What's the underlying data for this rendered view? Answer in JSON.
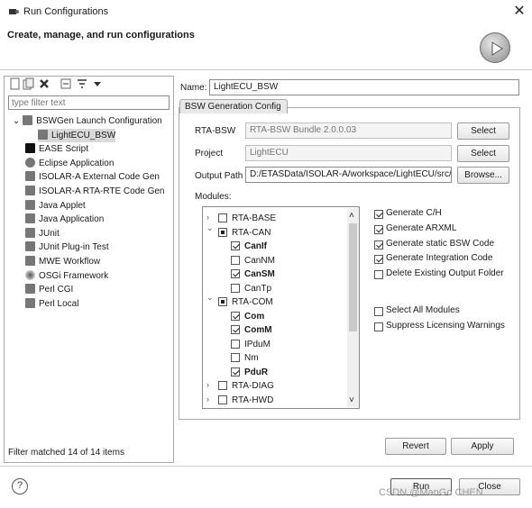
{
  "window": {
    "title": "Run Configurations",
    "close_glyph": "✕"
  },
  "header": {
    "title": "Create, manage, and run configurations",
    "run_icon": "run-play-icon"
  },
  "left": {
    "toolbar_icons": [
      "new-config-icon",
      "duplicate-icon",
      "delete-icon",
      "collapse-all-icon",
      "filter-icon",
      "view-menu-icon"
    ],
    "filter_placeholder": "type filter text",
    "tree": [
      {
        "label": "BSWGen Launch Configuration",
        "icon": "bswgen-icon",
        "expanded": true
      },
      {
        "label": "LightECU_BSW",
        "icon": "config-icon",
        "selected": true
      },
      {
        "label": "EASE Script",
        "icon": "ease-icon"
      },
      {
        "label": "Eclipse Application",
        "icon": "eclipse-icon"
      },
      {
        "label": "ISOLAR-A External Code Gen",
        "icon": "doc-icon"
      },
      {
        "label": "ISOLAR-A RTA-RTE Code Gen",
        "icon": "doc-icon"
      },
      {
        "label": "Java Applet",
        "icon": "java-icon"
      },
      {
        "label": "Java Application",
        "icon": "java-app-icon"
      },
      {
        "label": "JUnit",
        "icon": "junit-icon"
      },
      {
        "label": "JUnit Plug-in Test",
        "icon": "junit-plugin-icon"
      },
      {
        "label": "MWE Workflow",
        "icon": "mwe-icon"
      },
      {
        "label": "OSGi Framework",
        "icon": "osgi-icon"
      },
      {
        "label": "Perl CGI",
        "icon": "perl-icon"
      },
      {
        "label": "Perl Local",
        "icon": "perl-icon"
      }
    ],
    "filter_status": "Filter matched 14 of 14 items"
  },
  "right": {
    "name_label": "Name:",
    "name_value": "LightECU_BSW",
    "tab_label": "BSW Generation Config",
    "rta_bsw_label": "RTA-BSW",
    "rta_bsw_value": "RTA-BSW Bundle 2.0.0.03",
    "project_label": "Project",
    "project_value": "LightECU",
    "output_label": "Output Path",
    "output_value": "D:/ETASData/ISOLAR-A/workspace/LightECU/src/",
    "select_label": "Select",
    "browse_label": "Browse...",
    "modules_label": "Modules:",
    "modules": [
      {
        "label": "RTA-BASE",
        "level": 0,
        "arrow": "›",
        "state": "off",
        "bold": false
      },
      {
        "label": "RTA-CAN",
        "level": 0,
        "arrow": "⌄",
        "state": "part",
        "bold": false
      },
      {
        "label": "CanIf",
        "level": 1,
        "state": "on",
        "bold": true
      },
      {
        "label": "CanNM",
        "level": 1,
        "state": "off",
        "bold": false
      },
      {
        "label": "CanSM",
        "level": 1,
        "state": "on",
        "bold": true
      },
      {
        "label": "CanTp",
        "level": 1,
        "state": "off",
        "bold": false
      },
      {
        "label": "RTA-COM",
        "level": 0,
        "arrow": "⌄",
        "state": "part",
        "bold": false
      },
      {
        "label": "Com",
        "level": 1,
        "state": "on",
        "bold": true
      },
      {
        "label": "ComM",
        "level": 1,
        "state": "on",
        "bold": true
      },
      {
        "label": "IPduM",
        "level": 1,
        "state": "off",
        "bold": false
      },
      {
        "label": "Nm",
        "level": 1,
        "state": "off",
        "bold": false
      },
      {
        "label": "PduR",
        "level": 1,
        "state": "on",
        "bold": true
      },
      {
        "label": "RTA-DIAG",
        "level": 0,
        "arrow": "›",
        "state": "off",
        "bold": false
      },
      {
        "label": "RTA-HWD",
        "level": 0,
        "arrow": "›",
        "state": "off",
        "bold": false
      }
    ],
    "options": [
      {
        "label": "Generate C/H",
        "checked": true
      },
      {
        "label": "Generate ARXML",
        "checked": true
      },
      {
        "label": "Generate static BSW Code",
        "checked": true
      },
      {
        "label": "Generate Integration Code",
        "checked": true
      },
      {
        "label": "Delete Existing Output Folder",
        "checked": false
      }
    ],
    "options2": [
      {
        "label": "Select All Modules",
        "checked": false
      },
      {
        "label": "Suppress Licensing Warnings",
        "checked": false
      }
    ],
    "revert_label": "Revert",
    "apply_label": "Apply"
  },
  "footer": {
    "help_glyph": "?",
    "run_label": "Run",
    "close_label": "Close",
    "watermark": "CSDN @ManGo CHEN"
  }
}
